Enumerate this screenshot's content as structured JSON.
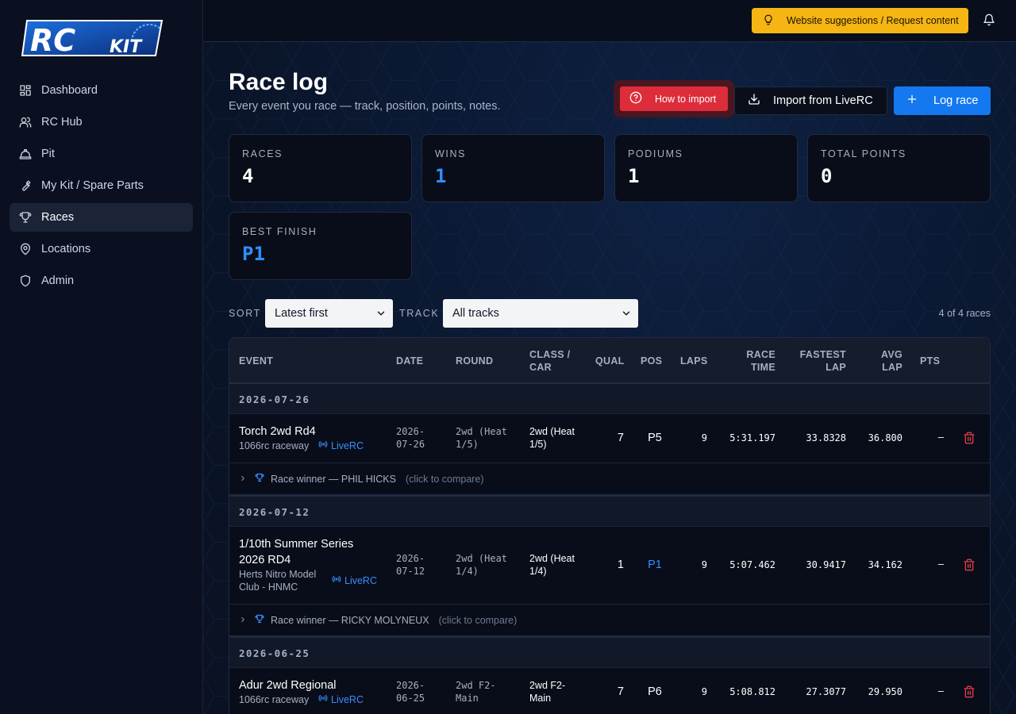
{
  "app": {
    "logo": "RC KIT",
    "colors": {
      "accent": "#1478f0",
      "suggest": "#f5b512",
      "danger": "#dd2c3a",
      "win": "#2e90ff"
    }
  },
  "sidebar": {
    "items": [
      {
        "label": "Dashboard",
        "icon": "dashboard-icon"
      },
      {
        "label": "RC Hub",
        "icon": "users-icon"
      },
      {
        "label": "Pit",
        "icon": "hard-hat-icon"
      },
      {
        "label": "My Kit / Spare Parts",
        "icon": "wrench-icon"
      },
      {
        "label": "Races",
        "icon": "trophy-icon",
        "active": true
      },
      {
        "label": "Locations",
        "icon": "map-pin-icon"
      },
      {
        "label": "Admin",
        "icon": "shield-icon"
      }
    ]
  },
  "topbar": {
    "suggest_label": "Website suggestions / Request content"
  },
  "header": {
    "title": "Race log",
    "subtitle": "Every event you race — track, position, points, notes.",
    "howto_label": "How to import",
    "import_label": "Import from LiveRC",
    "log_label": "Log race"
  },
  "stats": [
    {
      "label": "Races",
      "value": "4"
    },
    {
      "label": "Wins",
      "value": "1"
    },
    {
      "label": "Podiums",
      "value": "1"
    },
    {
      "label": "Total points",
      "value": "0"
    },
    {
      "label": "Best finish",
      "value": "P1"
    }
  ],
  "filters": {
    "sort_label": "SORT",
    "sort_value": "Latest first",
    "track_label": "TRACK",
    "track_value": "All tracks",
    "count": "4 of 4 races"
  },
  "table": {
    "headers": {
      "event": "EVENT",
      "date": "DATE",
      "round": "ROUND",
      "class1": "CLASS /",
      "class2": "CAR",
      "qual": "QUAL",
      "pos": "POS",
      "laps": "LAPS",
      "race1": "RACE",
      "race2": "TIME",
      "fastest1": "FASTEST",
      "fastest2": "LAP",
      "avg1": "AVG",
      "avg2": "LAP",
      "pts": "PTS"
    },
    "groups": [
      {
        "date": "2026-07-26",
        "race": {
          "event": "Torch 2wd Rd4",
          "location": "1066rc raceway",
          "source": "LiveRC",
          "date1": "2026-",
          "date2": "07-26",
          "round1": "2wd (Heat",
          "round2": "1/5)",
          "class1": "2wd (Heat",
          "class2": "1/5)",
          "qual": "7",
          "pos": "P5",
          "laps": "9",
          "race_time": "5:31.197",
          "fastest": "33.8328",
          "avg": "36.800",
          "pts": "—"
        },
        "winner": {
          "text": "Race winner — PHIL HICKS",
          "compare": "(click to compare)"
        }
      },
      {
        "date": "2026-07-12",
        "race": {
          "event1": "1/10th Summer Series",
          "event2": "2026 RD4",
          "location1": "Herts Nitro Model",
          "location2": "Club - HNMC",
          "source": "LiveRC",
          "date1": "2026-",
          "date2": "07-12",
          "round1": "2wd (Heat",
          "round2": "1/4)",
          "class1": "2wd (Heat",
          "class2": "1/4)",
          "qual": "1",
          "pos": "P1",
          "laps": "9",
          "race_time": "5:07.462",
          "fastest": "30.9417",
          "avg": "34.162",
          "pts": "—"
        },
        "winner": {
          "text": "Race winner — RICKY MOLYNEUX",
          "compare": "(click to compare)"
        }
      },
      {
        "date": "2026-06-25",
        "race": {
          "event": "Adur 2wd Regional",
          "location": "1066rc raceway",
          "source": "LiveRC",
          "date1": "2026-",
          "date2": "06-25",
          "round1": "2wd F2-",
          "round2": "Main",
          "class1": "2wd F2-",
          "class2": "Main",
          "qual": "7",
          "pos": "P6",
          "laps": "9",
          "race_time": "5:08.812",
          "fastest": "27.3077",
          "avg": "29.950",
          "pts": "—"
        }
      }
    ]
  }
}
